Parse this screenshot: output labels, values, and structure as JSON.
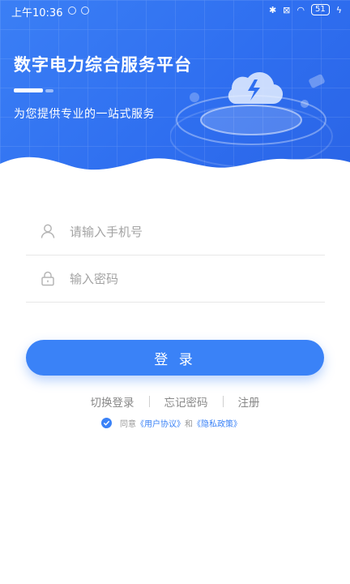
{
  "status_bar": {
    "time": "上午10:36",
    "battery": "51"
  },
  "header": {
    "title": "数字电力综合服务平台",
    "subtitle": "为您提供专业的一站式服务"
  },
  "form": {
    "phone_placeholder": "请输入手机号",
    "password_placeholder": "输入密码",
    "login_label": "登 录"
  },
  "links": {
    "switch_login": "切换登录",
    "forgot_password": "忘记密码",
    "register": "注册"
  },
  "agreement": {
    "prefix": "同意",
    "user_agreement": "《用户协议》",
    "and": "和",
    "privacy_policy": "《隐私政策》"
  },
  "colors": {
    "brand": "#3a82f7",
    "hero": "#2f6ff0"
  },
  "icons": [
    "user-icon",
    "lock-icon",
    "check-icon",
    "cloud-bolt-icon",
    "bluetooth-icon",
    "wifi-icon",
    "battery-icon"
  ]
}
